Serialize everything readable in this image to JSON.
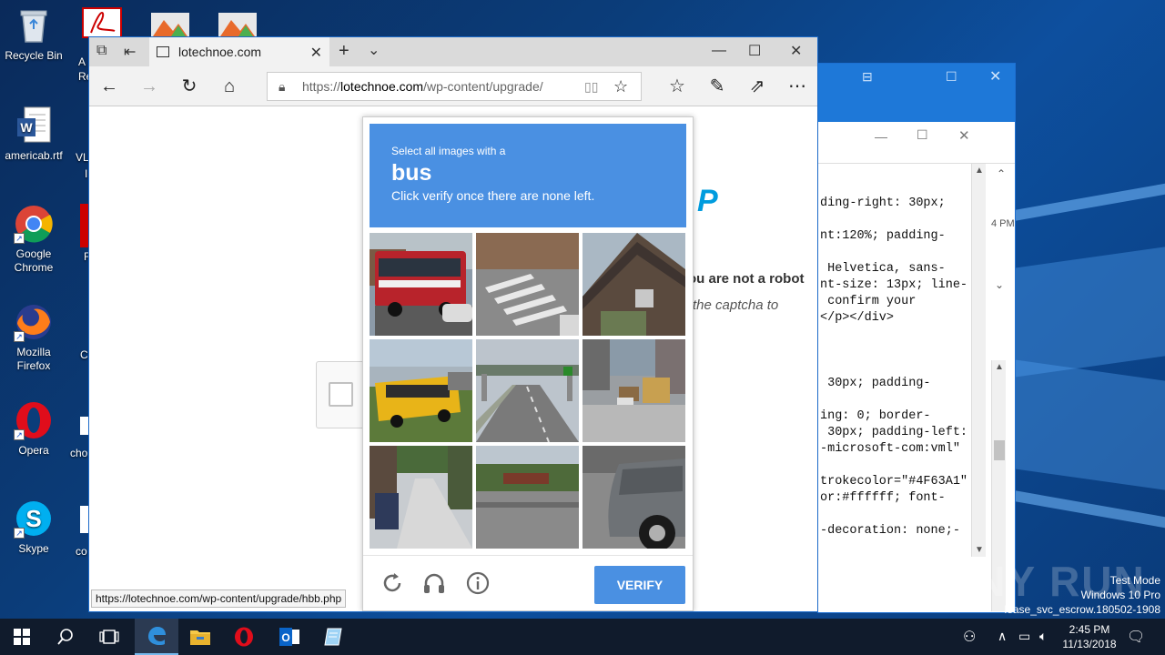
{
  "desktop": {
    "icons": [
      {
        "label": "Recycle Bin"
      },
      {
        "label": "americab.rtf"
      },
      {
        "label": "Google Chrome"
      },
      {
        "label": "Mozilla Firefox"
      },
      {
        "label": "Opera"
      },
      {
        "label": "Skype"
      }
    ],
    "partial_labels": [
      "A",
      "Re",
      "VL",
      "I",
      "F",
      "C",
      "cho",
      "co"
    ]
  },
  "browser": {
    "tab_title": "lotechnoe.com",
    "url_scheme": "https://",
    "url_host": "lotechnoe.com",
    "url_path": "/wp-content/upgrade/",
    "status_url": "https://lotechnoe.com/wp-content/upgrade/hbb.php"
  },
  "page": {
    "robot_text": "ou are not a robot",
    "captcha_text": "the captcha to",
    "brand_glyph": "P"
  },
  "captcha": {
    "instruction": "Select all images with a",
    "target": "bus",
    "subtext": "Click verify once there are none left.",
    "verify_label": "VERIFY",
    "tiles": [
      "bus-street",
      "crosswalk",
      "house-roof",
      "school-bus",
      "highway-overpass",
      "street-trucks",
      "alley-street",
      "road-trees",
      "car-side"
    ]
  },
  "editor": {
    "lines": [
      "ding-right: 30px;",
      "",
      "nt:120%; padding-",
      "",
      " Helvetica, sans-",
      "nt-size: 13px; line-",
      " confirm your",
      "</p></div>",
      "",
      "",
      "",
      " 30px; padding-",
      "",
      "ing: 0; border-",
      " 30px; padding-left:",
      "-microsoft-com:vml\"",
      "",
      "trokecolor=\"#4F63A1\"",
      "or:#ffffff; font-",
      "",
      "-decoration: none;-"
    ],
    "side_time": "4 PM"
  },
  "watermark": {
    "brand": "ANY RUN",
    "line1": "Test Mode",
    "line2": "Windows 10 Pro",
    "line3": "lease_svc_escrow.180502-1908"
  },
  "taskbar": {
    "time": "2:45 PM",
    "date": "11/13/2018"
  },
  "colors": {
    "captcha_blue": "#4a90e2",
    "edge_blue": "#1b6ac9",
    "taskbar": "#101b2c"
  }
}
